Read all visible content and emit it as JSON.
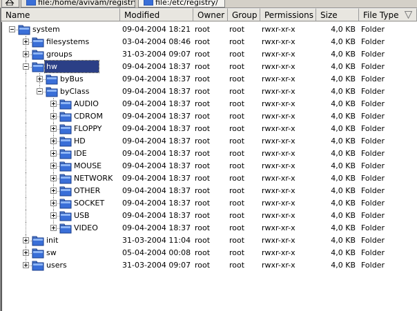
{
  "tabs": [
    {
      "label": "file:/home/avivam/registry"
    },
    {
      "label": "file:/etc/registry/"
    }
  ],
  "columns": {
    "name": "Name",
    "modified": "Modified",
    "owner": "Owner",
    "group": "Group",
    "permissions": "Permissions",
    "size": "Size",
    "file_type": "File Type"
  },
  "icons": {
    "home": "home-icon",
    "folder": "folder-icon",
    "sort": "sort-descending-icon"
  },
  "colors": {
    "selection": "#2b3f86",
    "folder": "#3a6fd8"
  },
  "rows": [
    {
      "name": "system",
      "level": 0,
      "expanded": true,
      "modified": "09-04-2004 18:21",
      "owner": "root",
      "group": "root",
      "permissions": "rwxr-xr-x",
      "size": "4,0 KB",
      "type": "Folder"
    },
    {
      "name": "filesystems",
      "level": 1,
      "expanded": false,
      "modified": "03-04-2004 08:46",
      "owner": "root",
      "group": "root",
      "permissions": "rwxr-xr-x",
      "size": "4,0 KB",
      "type": "Folder"
    },
    {
      "name": "groups",
      "level": 1,
      "expanded": false,
      "modified": "31-03-2004 09:07",
      "owner": "root",
      "group": "root",
      "permissions": "rwxr-xr-x",
      "size": "4,0 KB",
      "type": "Folder"
    },
    {
      "name": "hw",
      "level": 1,
      "expanded": true,
      "selected": true,
      "modified": "09-04-2004 18:37",
      "owner": "root",
      "group": "root",
      "permissions": "rwxr-xr-x",
      "size": "4,0 KB",
      "type": "Folder"
    },
    {
      "name": "byBus",
      "level": 2,
      "expanded": false,
      "modified": "09-04-2004 18:37",
      "owner": "root",
      "group": "root",
      "permissions": "rwxr-xr-x",
      "size": "4,0 KB",
      "type": "Folder"
    },
    {
      "name": "byClass",
      "level": 2,
      "expanded": true,
      "modified": "09-04-2004 18:37",
      "owner": "root",
      "group": "root",
      "permissions": "rwxr-xr-x",
      "size": "4,0 KB",
      "type": "Folder"
    },
    {
      "name": "AUDIO",
      "level": 3,
      "expanded": false,
      "modified": "09-04-2004 18:37",
      "owner": "root",
      "group": "root",
      "permissions": "rwxr-xr-x",
      "size": "4,0 KB",
      "type": "Folder"
    },
    {
      "name": "CDROM",
      "level": 3,
      "expanded": false,
      "modified": "09-04-2004 18:37",
      "owner": "root",
      "group": "root",
      "permissions": "rwxr-xr-x",
      "size": "4,0 KB",
      "type": "Folder"
    },
    {
      "name": "FLOPPY",
      "level": 3,
      "expanded": false,
      "modified": "09-04-2004 18:37",
      "owner": "root",
      "group": "root",
      "permissions": "rwxr-xr-x",
      "size": "4,0 KB",
      "type": "Folder"
    },
    {
      "name": "HD",
      "level": 3,
      "expanded": false,
      "modified": "09-04-2004 18:37",
      "owner": "root",
      "group": "root",
      "permissions": "rwxr-xr-x",
      "size": "4,0 KB",
      "type": "Folder"
    },
    {
      "name": "IDE",
      "level": 3,
      "expanded": false,
      "modified": "09-04-2004 18:37",
      "owner": "root",
      "group": "root",
      "permissions": "rwxr-xr-x",
      "size": "4,0 KB",
      "type": "Folder"
    },
    {
      "name": "MOUSE",
      "level": 3,
      "expanded": false,
      "modified": "09-04-2004 18:37",
      "owner": "root",
      "group": "root",
      "permissions": "rwxr-xr-x",
      "size": "4,0 KB",
      "type": "Folder"
    },
    {
      "name": "NETWORK",
      "level": 3,
      "expanded": false,
      "modified": "09-04-2004 18:37",
      "owner": "root",
      "group": "root",
      "permissions": "rwxr-xr-x",
      "size": "4,0 KB",
      "type": "Folder"
    },
    {
      "name": "OTHER",
      "level": 3,
      "expanded": false,
      "modified": "09-04-2004 18:37",
      "owner": "root",
      "group": "root",
      "permissions": "rwxr-xr-x",
      "size": "4,0 KB",
      "type": "Folder"
    },
    {
      "name": "SOCKET",
      "level": 3,
      "expanded": false,
      "modified": "09-04-2004 18:37",
      "owner": "root",
      "group": "root",
      "permissions": "rwxr-xr-x",
      "size": "4,0 KB",
      "type": "Folder"
    },
    {
      "name": "USB",
      "level": 3,
      "expanded": false,
      "modified": "09-04-2004 18:37",
      "owner": "root",
      "group": "root",
      "permissions": "rwxr-xr-x",
      "size": "4,0 KB",
      "type": "Folder"
    },
    {
      "name": "VIDEO",
      "level": 3,
      "expanded": false,
      "modified": "09-04-2004 18:37",
      "owner": "root",
      "group": "root",
      "permissions": "rwxr-xr-x",
      "size": "4,0 KB",
      "type": "Folder"
    },
    {
      "name": "init",
      "level": 1,
      "expanded": false,
      "modified": "31-03-2004 11:04",
      "owner": "root",
      "group": "root",
      "permissions": "rwxr-xr-x",
      "size": "4,0 KB",
      "type": "Folder"
    },
    {
      "name": "sw",
      "level": 1,
      "expanded": false,
      "modified": "05-04-2004 00:08",
      "owner": "root",
      "group": "root",
      "permissions": "rwxr-xr-x",
      "size": "4,0 KB",
      "type": "Folder"
    },
    {
      "name": "users",
      "level": 1,
      "expanded": false,
      "modified": "31-03-2004 09:07",
      "owner": "root",
      "group": "root",
      "permissions": "rwxr-xr-x",
      "size": "4,0 KB",
      "type": "Folder"
    }
  ]
}
